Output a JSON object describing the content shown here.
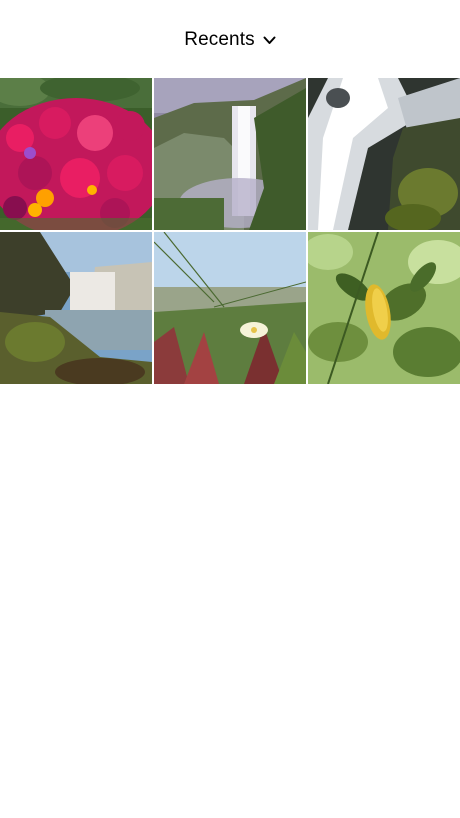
{
  "header": {
    "album_title": "Recents",
    "chevron_icon": "chevron-down-icon"
  },
  "photos": [
    {
      "subject": "pink-flowers"
    },
    {
      "subject": "waterfall-cliff"
    },
    {
      "subject": "waterfall-rocks"
    },
    {
      "subject": "waterfall-river"
    },
    {
      "subject": "grass-ice-plant"
    },
    {
      "subject": "green-leaves"
    }
  ]
}
